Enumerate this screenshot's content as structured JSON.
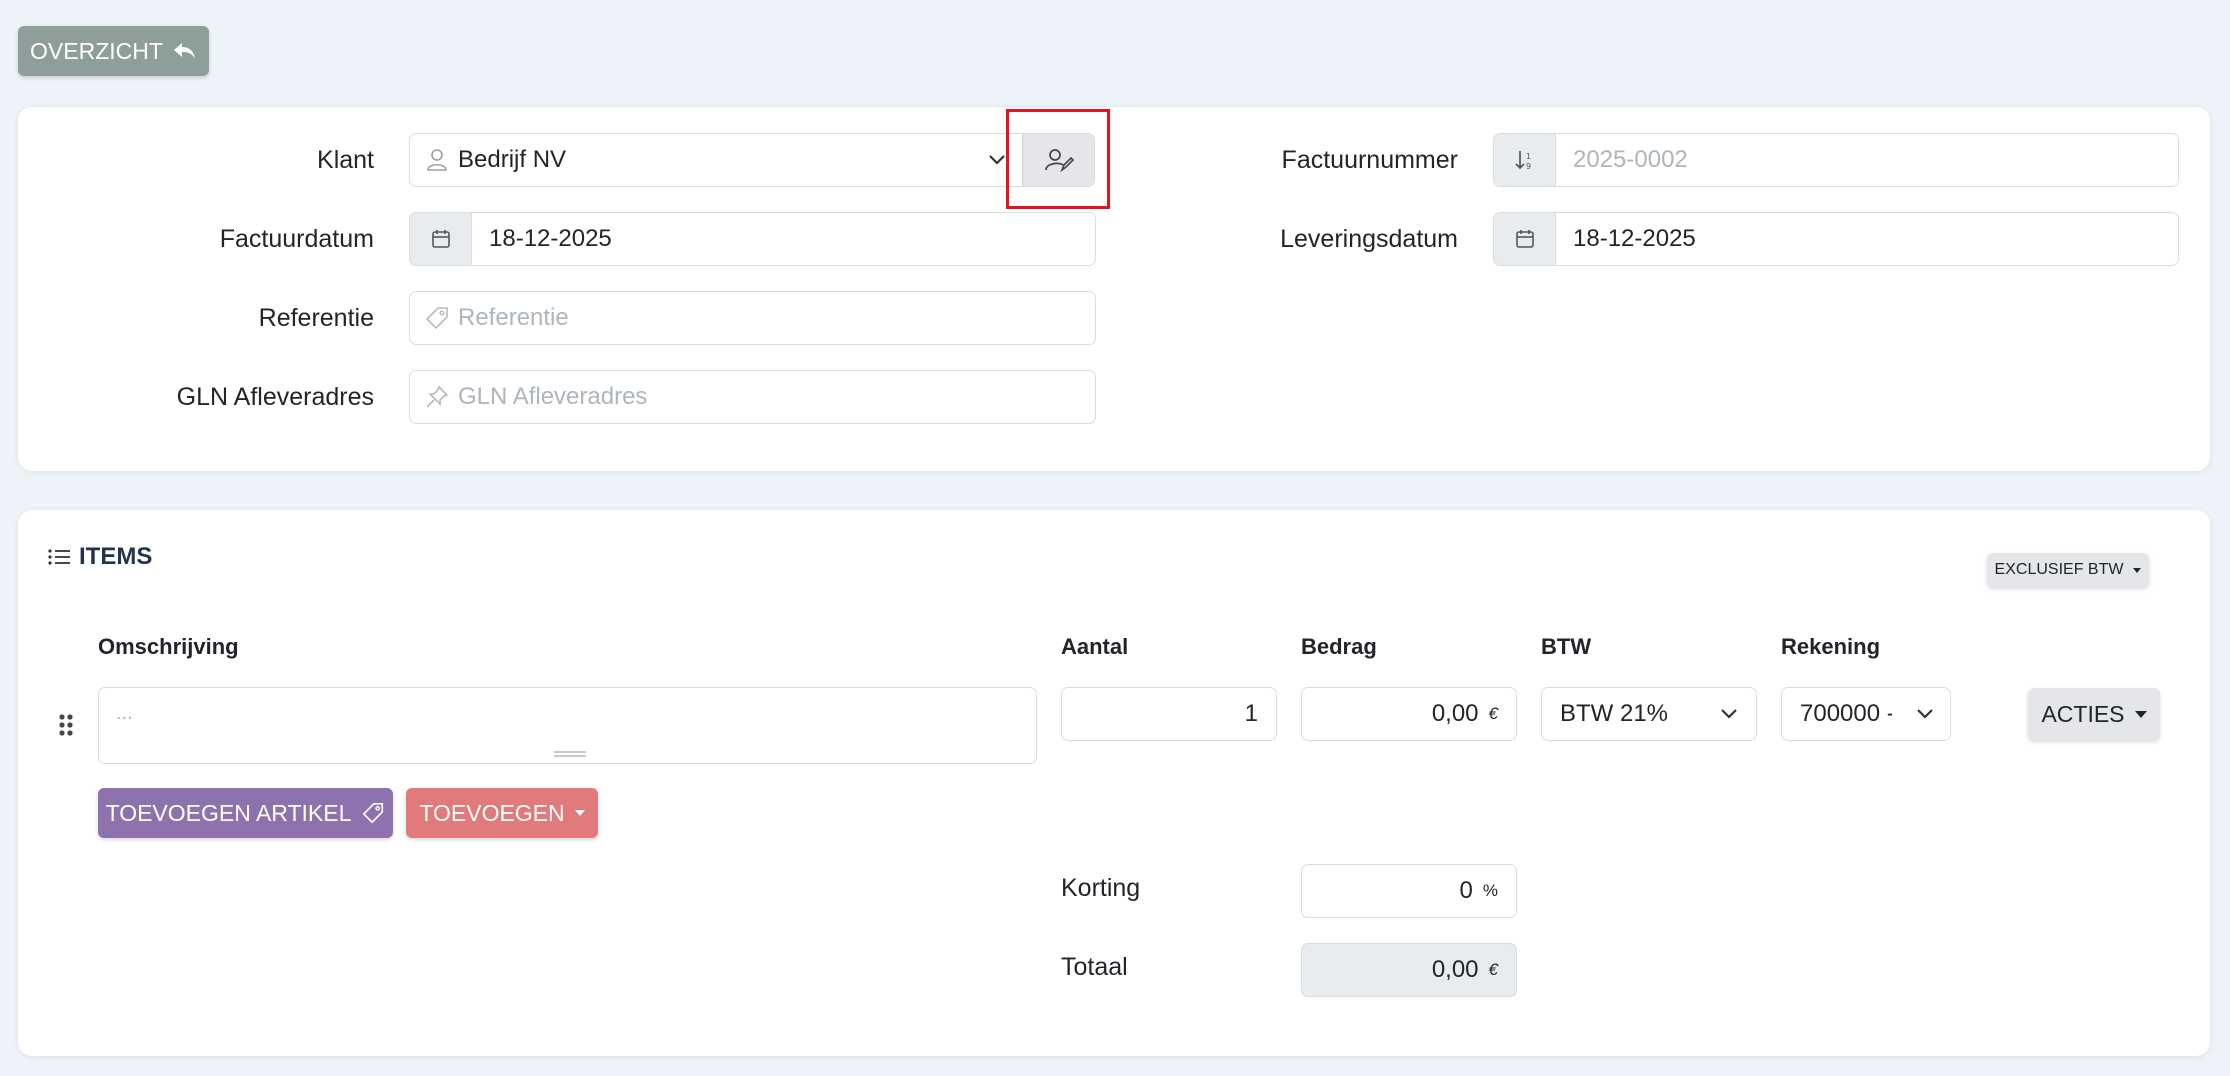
{
  "toolbar": {
    "back_label": "OVERZICHT"
  },
  "form": {
    "klant": {
      "label": "Klant",
      "value": "Bedrijf NV"
    },
    "factuurdatum": {
      "label": "Factuurdatum",
      "value": "18-12-2025"
    },
    "referentie": {
      "label": "Referentie",
      "placeholder": "Referentie"
    },
    "gln": {
      "label": "GLN Afleveradres",
      "placeholder": "GLN Afleveradres"
    },
    "factuurnummer": {
      "label": "Factuurnummer",
      "placeholder": "2025-0002"
    },
    "leveringsdatum": {
      "label": "Leveringsdatum",
      "value": "18-12-2025"
    }
  },
  "items": {
    "title": "ITEMS",
    "vat_mode": "EXCLUSIEF BTW",
    "columns": {
      "omschrijving": "Omschrijving",
      "aantal": "Aantal",
      "bedrag": "Bedrag",
      "btw": "BTW",
      "rekening": "Rekening"
    },
    "row": {
      "description_placeholder": "...",
      "aantal": "1",
      "bedrag": "0,00",
      "bedrag_unit": "€",
      "btw": "BTW 21%",
      "rekening": "700000 - '",
      "acties": "ACTIES"
    },
    "add_article_label": "TOEVOEGEN ARTIKEL",
    "add_label": "TOEVOEGEN",
    "korting": {
      "label": "Korting",
      "value": "0",
      "unit": "%"
    },
    "totaal": {
      "label": "Totaal",
      "value": "0,00",
      "unit": "€"
    }
  },
  "colors": {
    "back_button": "#8e9e9a",
    "add_article_button": "#8e72ad",
    "add_button": "#e17a7a",
    "highlight_box": "#e0161c",
    "background": "#eef2f9"
  }
}
